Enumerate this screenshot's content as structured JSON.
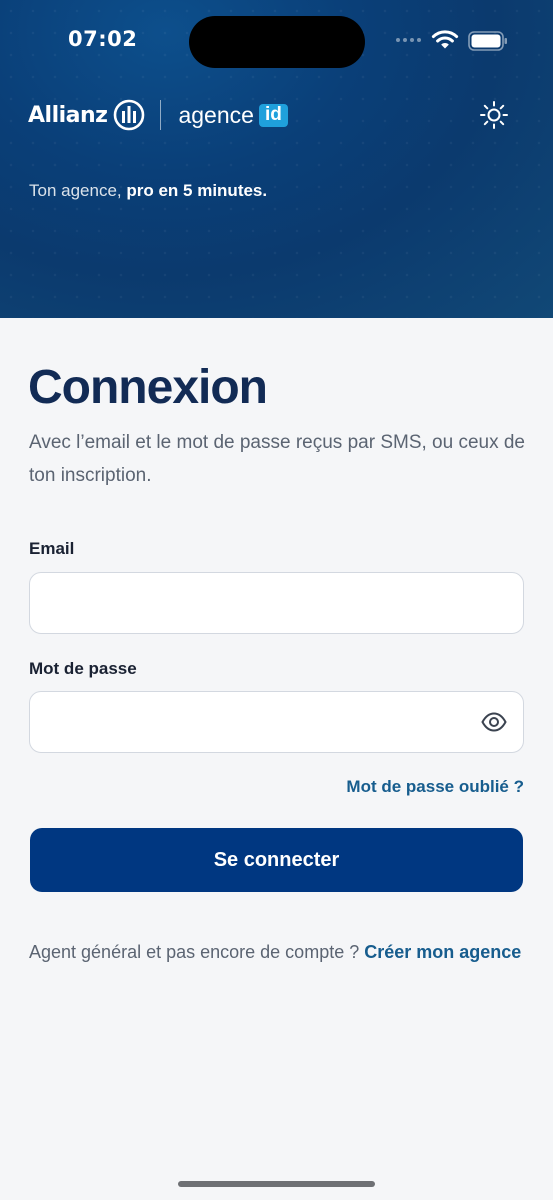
{
  "status_bar": {
    "time": "07:02"
  },
  "header": {
    "brand_name": "Allianz",
    "product_name": "agence",
    "product_badge": "id",
    "tagline_prefix": "Ton agence, ",
    "tagline_bold": "pro en 5 minutes."
  },
  "login": {
    "title": "Connexion",
    "subtitle": "Avec l’email et le mot de passe reçus par SMS, ou ceux de ton inscription.",
    "email_label": "Email",
    "email_value": "",
    "password_label": "Mot de passe",
    "password_value": "",
    "forgot_password": "Mot de passe oublié ?",
    "submit_label": "Se connecter",
    "signup_prompt": "Agent général et pas encore de compte ? ",
    "signup_link": "Créer mon agence"
  },
  "colors": {
    "hero_blue": "#0a3f78",
    "primary_button": "#003781",
    "link": "#175d8e",
    "badge": "#1fa0dc",
    "title": "#122b55"
  },
  "icons": {
    "theme_toggle": "sun-icon",
    "password_visibility": "eye-icon",
    "brand_logo": "allianz-eagle-icon"
  }
}
